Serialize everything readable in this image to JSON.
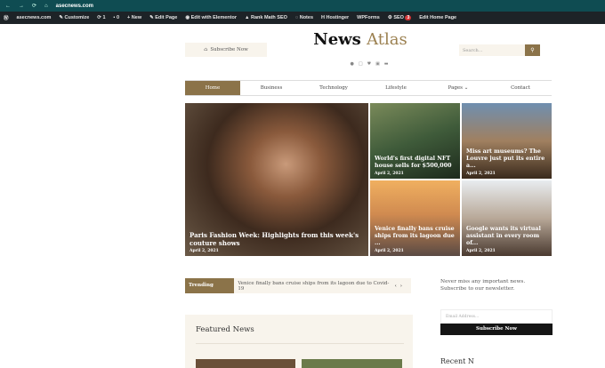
{
  "browser": {
    "url": "asecnews.com"
  },
  "adminbar": {
    "items": [
      "asecnews.com",
      "Customize",
      "1",
      "0",
      "New",
      "Edit Page",
      "Edit with Elementor",
      "Rank Math SEO",
      "Notes",
      "Hostinger",
      "WPForms",
      "SEO",
      "Edit Home Page"
    ],
    "seo_badge": "3"
  },
  "header": {
    "subscribe": "Subscribe Now",
    "logo_a": "News",
    "logo_b": "Atlas",
    "search_placeholder": "Search..."
  },
  "nav": [
    "Home",
    "Business",
    "Technology",
    "Lifestyle",
    "Pages",
    "Contact"
  ],
  "posts": [
    {
      "title": "Paris Fashion Week: Highlights from this week's couture shows",
      "date": "April 2, 2021"
    },
    {
      "title": "World's first digital NFT house sells for $500,000",
      "date": "April 2, 2021"
    },
    {
      "title": "Miss art museums? The Louvre just put its entire a...",
      "date": "April 2, 2021"
    },
    {
      "title": "Venice finally bans cruise ships from its lagoon due ...",
      "date": "April 2, 2021"
    },
    {
      "title": "Google wants its virtual assistant in every room of...",
      "date": "April 2, 2021"
    }
  ],
  "trending": {
    "label": "Trending Today",
    "text": "Venice finally bans cruise ships from its lagoon due to Covid-19"
  },
  "newsletter": {
    "text": "Never miss any important news. Subscribe to our newsletter.",
    "placeholder": "Email Address...",
    "button": "Subscribe Now"
  },
  "featured": {
    "title": "Featured News"
  },
  "recent": {
    "title": "Recent N"
  }
}
